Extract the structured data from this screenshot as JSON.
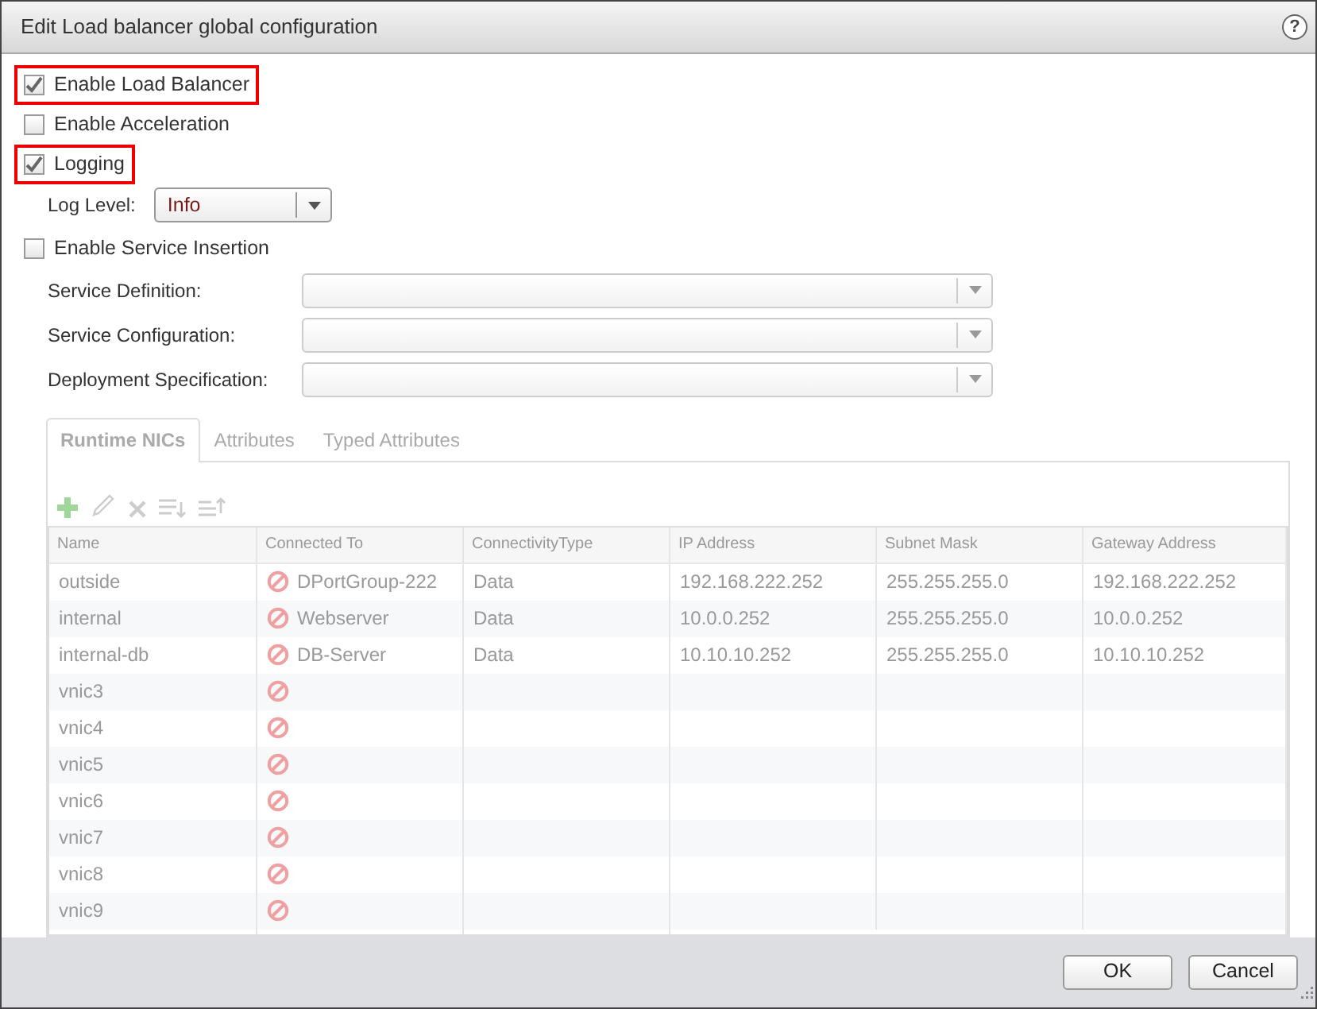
{
  "window": {
    "title": "Edit Load balancer global configuration",
    "help": "?"
  },
  "options": [
    {
      "label": "Enable Load Balancer",
      "checked": true,
      "highlighted": true
    },
    {
      "label": "Enable Acceleration",
      "checked": false,
      "highlighted": false
    },
    {
      "label": "Logging",
      "checked": true,
      "highlighted": true
    }
  ],
  "log_level": {
    "label": "Log Level:",
    "value": "Info"
  },
  "service_insertion": {
    "label": "Enable Service Insertion",
    "checked": false
  },
  "service_fields": [
    {
      "label": "Service Definition:"
    },
    {
      "label": "Service Configuration:"
    },
    {
      "label": "Deployment Specification:"
    }
  ],
  "tabs": [
    {
      "label": "Runtime NICs",
      "selected": true
    },
    {
      "label": "Attributes",
      "selected": false
    },
    {
      "label": "Typed Attributes",
      "selected": false
    }
  ],
  "table": {
    "columns": [
      "Name",
      "Connected To",
      "ConnectivityType",
      "IP Address",
      "Subnet Mask",
      "Gateway Address"
    ],
    "rows": [
      {
        "name": "outside",
        "connected_to": "DPortGroup-222",
        "type": "Data",
        "ip": "192.168.222.252",
        "subnet": "255.255.255.0",
        "gateway": "192.168.222.252"
      },
      {
        "name": "internal",
        "connected_to": "Webserver",
        "type": "Data",
        "ip": "10.0.0.252",
        "subnet": "255.255.255.0",
        "gateway": "10.0.0.252"
      },
      {
        "name": "internal-db",
        "connected_to": "DB-Server",
        "type": "Data",
        "ip": "10.10.10.252",
        "subnet": "255.255.255.0",
        "gateway": "10.10.10.252"
      },
      {
        "name": "vnic3"
      },
      {
        "name": "vnic4"
      },
      {
        "name": "vnic5"
      },
      {
        "name": "vnic6"
      },
      {
        "name": "vnic7"
      },
      {
        "name": "vnic8"
      },
      {
        "name": "vnic9"
      }
    ]
  },
  "buttons": [
    "OK",
    "Cancel"
  ]
}
